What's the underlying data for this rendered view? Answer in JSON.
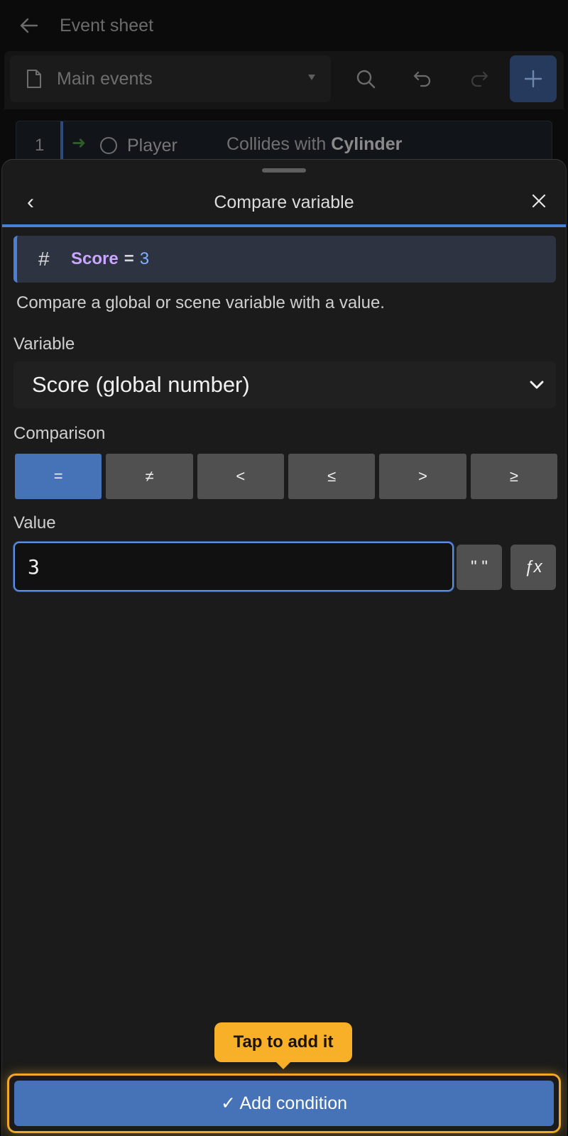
{
  "header": {
    "title": "Event sheet",
    "back_icon": "arrow-left-icon"
  },
  "toolbar": {
    "sheet_name": "Main events",
    "icons": [
      "document-icon",
      "search-icon",
      "undo-icon",
      "redo-icon",
      "plus-icon"
    ]
  },
  "event": {
    "number": "1",
    "object": "Player",
    "condition_prefix": "Collides with",
    "condition_target": "Cylinder"
  },
  "dialog": {
    "title": "Compare variable",
    "preview": {
      "hash": "#",
      "variable": "Score",
      "operator": "=",
      "value": "3"
    },
    "description": "Compare a global or scene variable with a value.",
    "variable_label": "Variable",
    "variable_value": "Score (global number)",
    "comparison_label": "Comparison",
    "comparison_options": [
      "=",
      "≠",
      "<",
      "≤",
      ">",
      "≥"
    ],
    "comparison_selected": "=",
    "value_label": "Value",
    "value_input": "3",
    "quote_button": "\" \"",
    "fx_button": "ƒx"
  },
  "tooltip": "Tap to add it",
  "add_button": "✓ Add condition",
  "colors": {
    "accent": "#4672b8",
    "highlight": "#f7b027",
    "variable_name": "#c9a6ff",
    "value_blue": "#7fb0ff"
  }
}
